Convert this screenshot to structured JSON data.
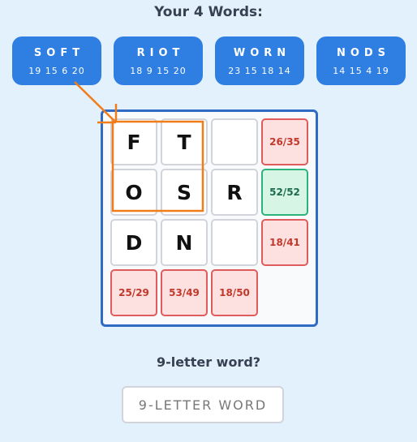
{
  "header": {
    "title": "Your 4 Words:"
  },
  "words": [
    {
      "letters": "SOFT",
      "numbers": "19 15 6 20"
    },
    {
      "letters": "RIOT",
      "numbers": "18 9 15 20"
    },
    {
      "letters": "WORN",
      "numbers": "23 15 18 14"
    },
    {
      "letters": "NODS",
      "numbers": "14 15 4 19"
    }
  ],
  "grid": {
    "rows": [
      [
        "F",
        "T",
        "",
        "26/35"
      ],
      [
        "O",
        "S",
        "R",
        "52/52"
      ],
      [
        "D",
        "N",
        "",
        "18/41"
      ],
      [
        "25/29",
        "53/49",
        "18/50",
        ""
      ]
    ],
    "score_status": {
      "0-3": "bad",
      "1-3": "good",
      "2-3": "bad",
      "3-0": "bad",
      "3-1": "bad",
      "3-2": "bad"
    }
  },
  "colors": {
    "accent": "#2f7fe3",
    "highlight": "#f07c1a",
    "bad": "#e05c5c",
    "good": "#2bb37b"
  },
  "question": "9-letter word?",
  "answer": {
    "placeholder": "9-LETTER WORD",
    "value": ""
  }
}
